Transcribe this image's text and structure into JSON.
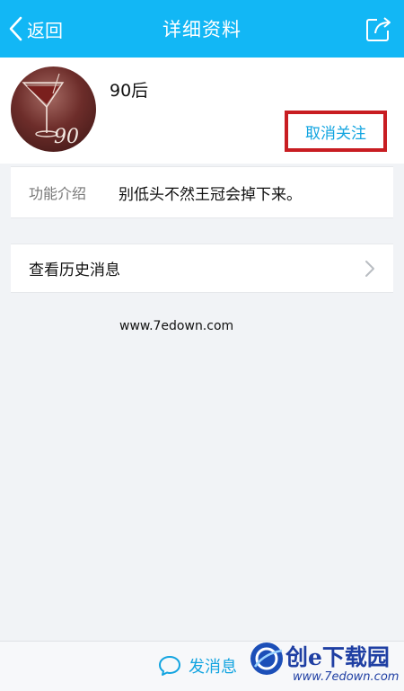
{
  "header": {
    "back_label": "返回",
    "title": "详细资料"
  },
  "profile": {
    "nickname": "90后",
    "avatar_text": "90",
    "unfollow_label": "取消关注"
  },
  "intro": {
    "label": "功能介绍",
    "value": "别低头不然王冠会掉下来。"
  },
  "history": {
    "label": "查看历史消息"
  },
  "watermark": {
    "text": "www.7edown.com"
  },
  "bottom": {
    "send_label": "发消息"
  },
  "site_logo": {
    "text": "创e下载园",
    "url": "www.7edown.com"
  },
  "colors": {
    "brand": "#12b7f5",
    "accent_text": "#12a4e0",
    "highlight_box": "#c81d22"
  }
}
